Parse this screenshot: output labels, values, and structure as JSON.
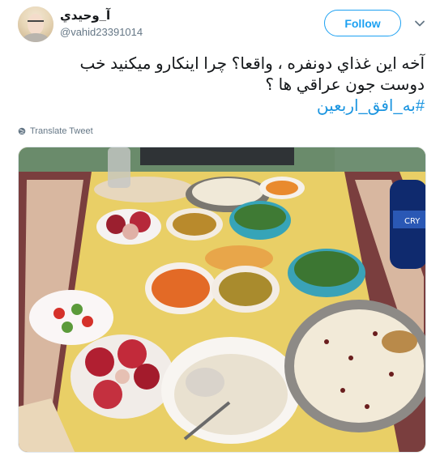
{
  "author": {
    "display_name": "آ_وحيدي",
    "handle": "@vahid23391014"
  },
  "follow_button": {
    "label": "Follow"
  },
  "tweet": {
    "line1": "آخه اين غذاي دونفره ، واقعا؟ چرا اينكارو  ميكنيد خب",
    "line2": "دوست جون عراقي ها ؟",
    "hashtag": "#به_افق_اربعين"
  },
  "translate": {
    "label": "Translate Tweet"
  },
  "icons": {
    "menu": "chevron-down-icon",
    "translate": "globe-icon"
  },
  "colors": {
    "accent": "#1da1f2",
    "hashtag": "#1b95e0",
    "secondary_text": "#657786"
  }
}
